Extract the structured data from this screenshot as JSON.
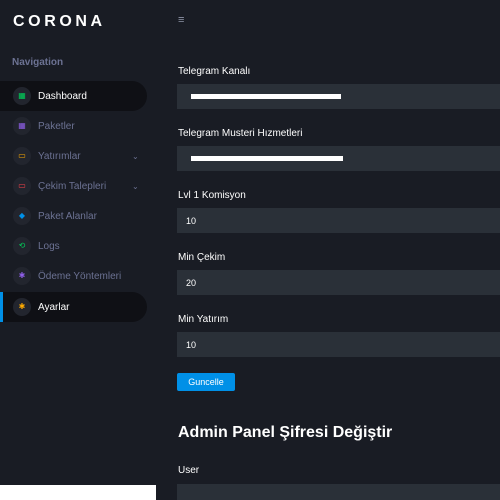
{
  "brand": "CORONA",
  "sidebar": {
    "caption": "Navigation",
    "items": [
      {
        "label": "Dashboard",
        "icon": "dashboard-icon",
        "color": "#00d25b",
        "glyph": "▦"
      },
      {
        "label": "Paketler",
        "icon": "grid-icon",
        "color": "#8f5fe8",
        "glyph": "▦"
      },
      {
        "label": "Yatırımlar",
        "icon": "laptop-icon",
        "color": "#ffab00",
        "glyph": "▭"
      },
      {
        "label": "Çekim Talepleri",
        "icon": "monitor-icon",
        "color": "#fc424a",
        "glyph": "▭"
      },
      {
        "label": "Paket Alanlar",
        "icon": "cube-icon",
        "color": "#0090e7",
        "glyph": "◆"
      },
      {
        "label": "Logs",
        "icon": "history-icon",
        "color": "#00d25b",
        "glyph": "⟲"
      },
      {
        "label": "Ödeme Yöntemleri",
        "icon": "settings-cog-icon",
        "color": "#8f5fe8",
        "glyph": "✱"
      },
      {
        "label": "Ayarlar",
        "icon": "gear-icon",
        "color": "#ffab00",
        "glyph": "✱"
      }
    ]
  },
  "topbar": {
    "toggle": "≡"
  },
  "form": {
    "fields": [
      {
        "label": "Telegram Kanalı",
        "value": ""
      },
      {
        "label": "Telegram Musteri Hızmetleri",
        "value": ""
      },
      {
        "label": "Lvl 1 Komisyon",
        "value": "10"
      },
      {
        "label": "Min Çekim",
        "value": "20"
      },
      {
        "label": "Min Yatırım",
        "value": "10"
      }
    ],
    "submit_label": "Guncelle"
  },
  "password_section": {
    "title": "Admin Panel Şifresi Değiştir",
    "user_label": "User"
  }
}
